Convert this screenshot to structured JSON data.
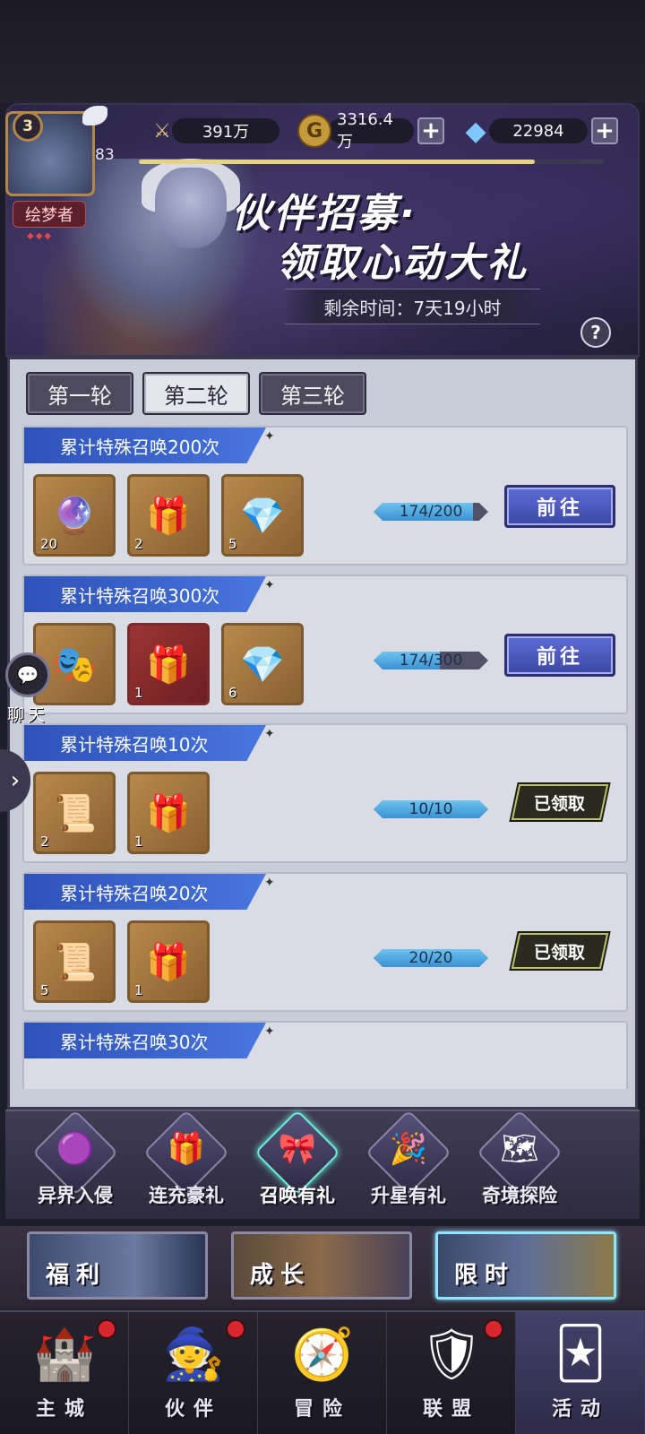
{
  "player": {
    "level": "3",
    "power_level": "83",
    "nickname": "绘梦者",
    "xp_fraction": 0.85
  },
  "currency": {
    "power": "391万",
    "gold": "3316.4万",
    "diamonds": "22984"
  },
  "banner": {
    "title_line1": "伙伴招募·",
    "title_line2": "领取心动大礼",
    "time_label": "剩余时间：7天19小时",
    "help": "?"
  },
  "tabs": [
    {
      "label": "第一轮",
      "active": false
    },
    {
      "label": "第二轮",
      "active": true
    },
    {
      "label": "第三轮",
      "active": false
    }
  ],
  "tasks": [
    {
      "title": "累计特殊召唤200次",
      "items": [
        {
          "icon": "crystal-coffin-icon",
          "glyph": "🔮",
          "count": "20"
        },
        {
          "icon": "gift-box-icon",
          "glyph": "🎁",
          "count": "2"
        },
        {
          "icon": "red-gem-icon",
          "glyph": "💎",
          "count": "5"
        }
      ],
      "progress": "174/200",
      "progress_fraction": 0.87,
      "status": "go",
      "button": "前往"
    },
    {
      "title": "累计特殊召唤300次",
      "items": [
        {
          "icon": "hero-portrait-icon",
          "glyph": "🎭",
          "count": ""
        },
        {
          "icon": "gift-box-icon",
          "glyph": "🎁",
          "count": "1"
        },
        {
          "icon": "red-gem-icon",
          "glyph": "💎",
          "count": "6"
        }
      ],
      "progress": "174/300",
      "progress_fraction": 0.58,
      "status": "go",
      "button": "前往"
    },
    {
      "title": "累计特殊召唤10次",
      "items": [
        {
          "icon": "golden-scroll-icon",
          "glyph": "📜",
          "count": "2"
        },
        {
          "icon": "gift-box-icon",
          "glyph": "🎁",
          "count": "1"
        }
      ],
      "progress": "10/10",
      "progress_fraction": 1.0,
      "status": "claimed",
      "button": "已领取"
    },
    {
      "title": "累计特殊召唤20次",
      "items": [
        {
          "icon": "golden-scroll-icon",
          "glyph": "📜",
          "count": "5"
        },
        {
          "icon": "gift-box-icon",
          "glyph": "🎁",
          "count": "1"
        }
      ],
      "progress": "20/20",
      "progress_fraction": 1.0,
      "status": "claimed",
      "button": "已领取"
    },
    {
      "title": "累计特殊召唤30次",
      "items": [],
      "progress": "",
      "progress_fraction": 0,
      "status": "partial",
      "button": ""
    }
  ],
  "chat": {
    "label": "聊天"
  },
  "activities": [
    {
      "label": "异界入侵",
      "glyph": "🟣",
      "active": false
    },
    {
      "label": "连充豪礼",
      "glyph": "🎁",
      "active": false
    },
    {
      "label": "召唤有礼",
      "glyph": "🎀",
      "active": true
    },
    {
      "label": "升星有礼",
      "glyph": "🎉",
      "active": false
    },
    {
      "label": "奇境探险",
      "glyph": "🗺",
      "active": false
    }
  ],
  "big_buttons": [
    {
      "label": "福利"
    },
    {
      "label": "成长"
    },
    {
      "label": "限时"
    }
  ],
  "nav": [
    {
      "label": "主城",
      "glyph": "🏰",
      "badge": true,
      "active": false
    },
    {
      "label": "伙伴",
      "glyph": "🧙",
      "badge": true,
      "active": false
    },
    {
      "label": "冒险",
      "glyph": "🧭",
      "badge": false,
      "active": false
    },
    {
      "label": "联盟",
      "glyph": "🛡",
      "badge": true,
      "active": false
    },
    {
      "label": "活动",
      "glyph": "🃏",
      "badge": false,
      "active": true
    }
  ]
}
